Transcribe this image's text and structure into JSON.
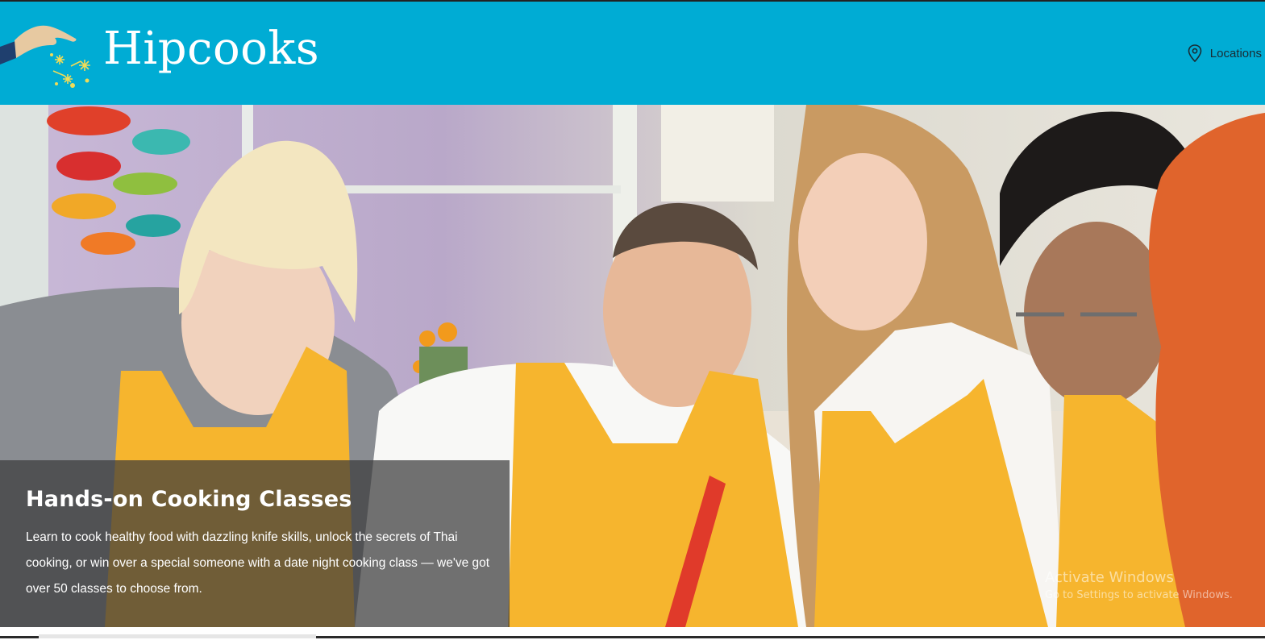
{
  "header": {
    "brand": "Hipcooks",
    "nav": {
      "locations_label": "Locations",
      "locations_icon": "map-pin-icon"
    },
    "colors": {
      "background": "#00acd4",
      "text": "#1a2b33"
    }
  },
  "hero": {
    "caption": {
      "title": "Hands-on Cooking Classes",
      "body": "Learn to cook healthy food with dazzling knife skills, unlock the secrets of Thai cooking, or win over a special someone with a date night cooking class — we've got over 50 classes to choose from."
    },
    "apron_color": "#f6b52e"
  },
  "os_watermark": {
    "title": "Activate Windows",
    "subtitle": "Go to Settings to activate Windows."
  }
}
